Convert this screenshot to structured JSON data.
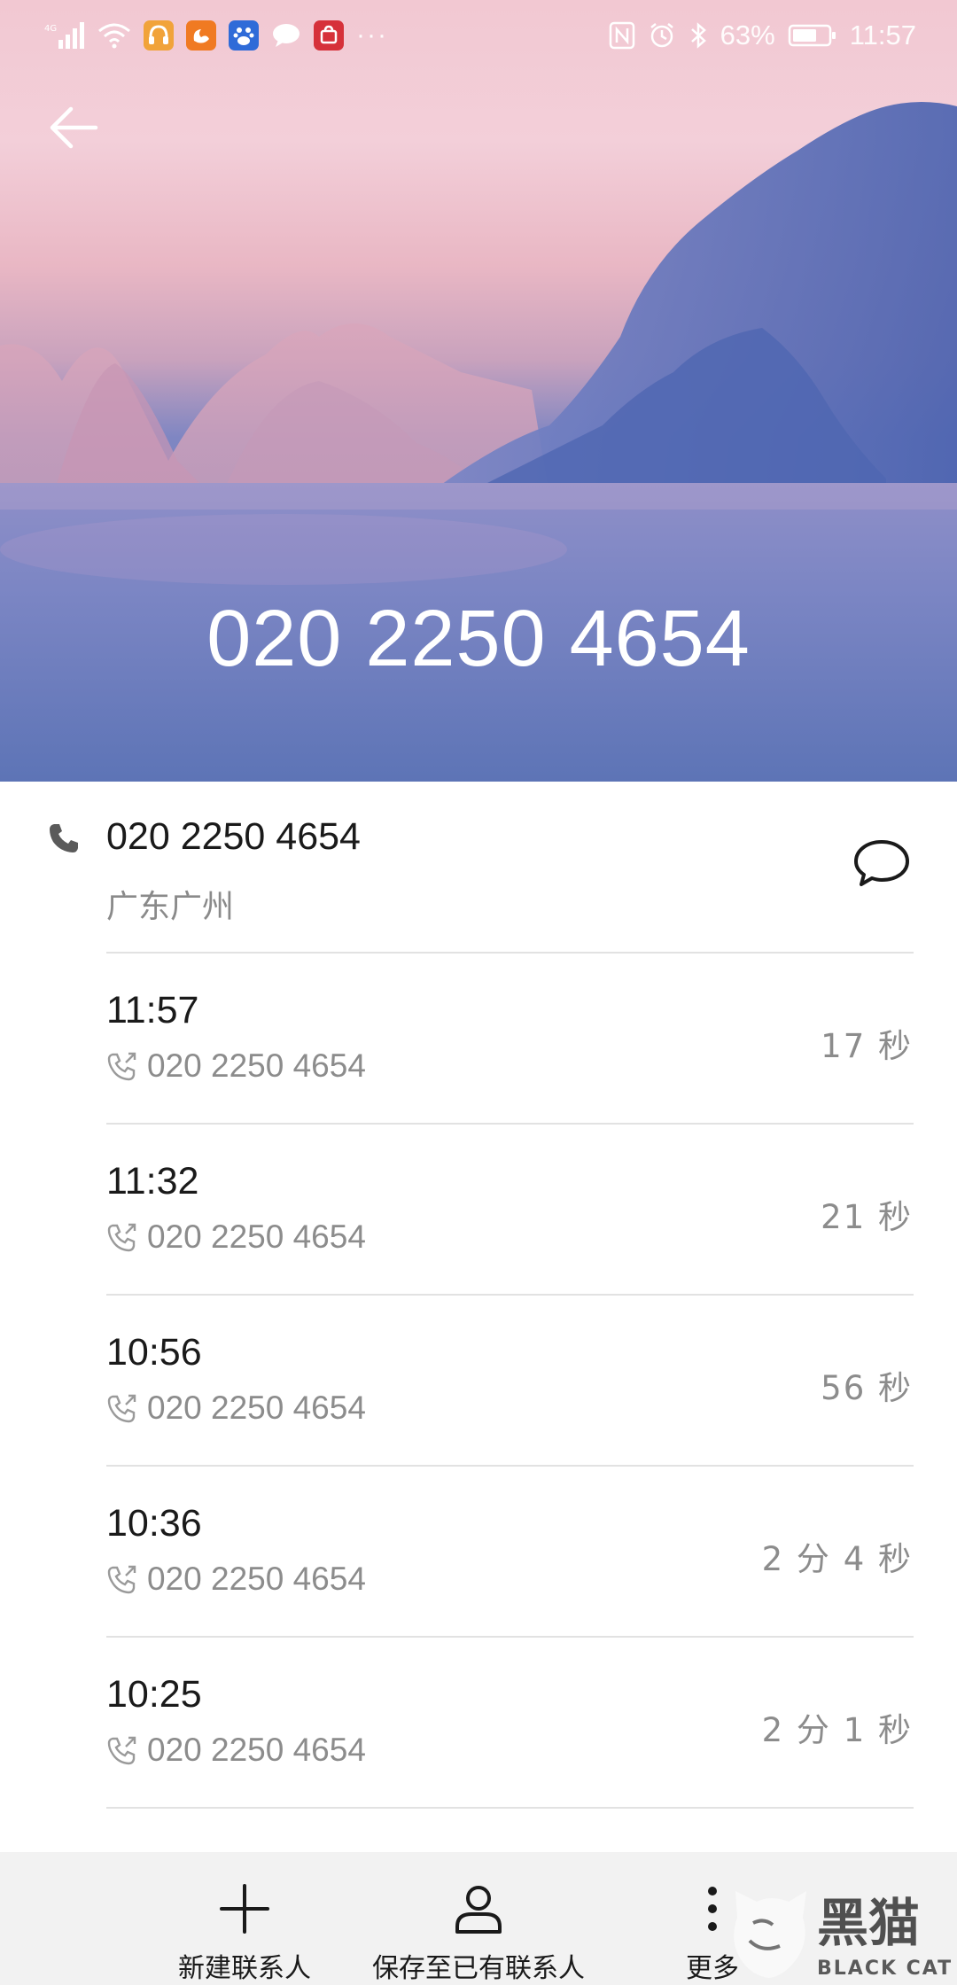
{
  "statusbar": {
    "network_label": "4G",
    "battery_percent": "63%",
    "time": "11:57",
    "more_dots": "···"
  },
  "hero": {
    "number": "020 2250 4654"
  },
  "contact": {
    "number": "020 2250 4654",
    "location": "广东广州"
  },
  "calls": [
    {
      "time": "11:57",
      "number": "020 2250 4654",
      "duration": "17 秒"
    },
    {
      "time": "11:32",
      "number": "020 2250 4654",
      "duration": "21 秒"
    },
    {
      "time": "10:56",
      "number": "020 2250 4654",
      "duration": "56 秒"
    },
    {
      "time": "10:36",
      "number": "020 2250 4654",
      "duration": "2 分 4 秒"
    },
    {
      "time": "10:25",
      "number": "020 2250 4654",
      "duration": "2 分 1 秒"
    }
  ],
  "bottom_bar": {
    "new_contact": "新建联系人",
    "save_existing": "保存至已有联系人",
    "more": "更多"
  },
  "watermark": {
    "text": "黑猫",
    "subtext": "BLACK CAT"
  },
  "icons": {
    "back": "arrow-left-icon",
    "phone": "phone-icon",
    "message": "chat-bubble-icon",
    "outgoing_call": "outgoing-call-icon",
    "add": "plus-icon",
    "person": "person-icon",
    "more": "vertical-dots-icon"
  },
  "colors": {
    "primary_text": "#1a1a1a",
    "secondary_text": "#8c8c8c",
    "divider": "#e2e2e2",
    "bottom_bar_bg": "#f2f2f2"
  }
}
